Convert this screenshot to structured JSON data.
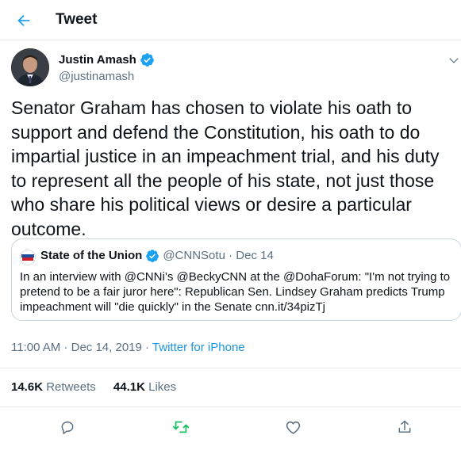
{
  "header": {
    "title": "Tweet",
    "back_icon": "arrow-left-icon"
  },
  "tweet": {
    "author_name": "Justin Amash",
    "handle": "@justinamash",
    "text": "Senator Graham has chosen to violate his oath to support and defend the Constitution, his oath to do impartial justice in an impeachment trial, and his duty to represent all the people of his state, not just those who share his political views or desire a particular outcome.",
    "time": "11:00 AM",
    "separator": " · ",
    "date": "Dec 14, 2019",
    "source": "Twitter for iPhone",
    "retweets_count": "14.6K",
    "retweets_label": "Retweets",
    "likes_count": "44.1K",
    "likes_label": "Likes"
  },
  "quote": {
    "name": "State of the Union",
    "handle": "@CNNSotu",
    "separator": " · ",
    "date": "Dec 14",
    "text": "In an interview with @CNNi’s @BeckyCNN at the @DohaForum: \"I'm not trying to pretend to be a fair juror here\": Republican Sen. Lindsey Graham predicts Trump impeachment will \"die quickly\" in the Senate cnn.it/34pizTj"
  },
  "colors": {
    "accent": "#1da1f2",
    "retweet": "#17bf63",
    "secondary_text": "#5b7083",
    "border": "#e6ecf0"
  },
  "actions": [
    "reply-icon",
    "retweet-icon",
    "like-icon",
    "share-icon"
  ]
}
